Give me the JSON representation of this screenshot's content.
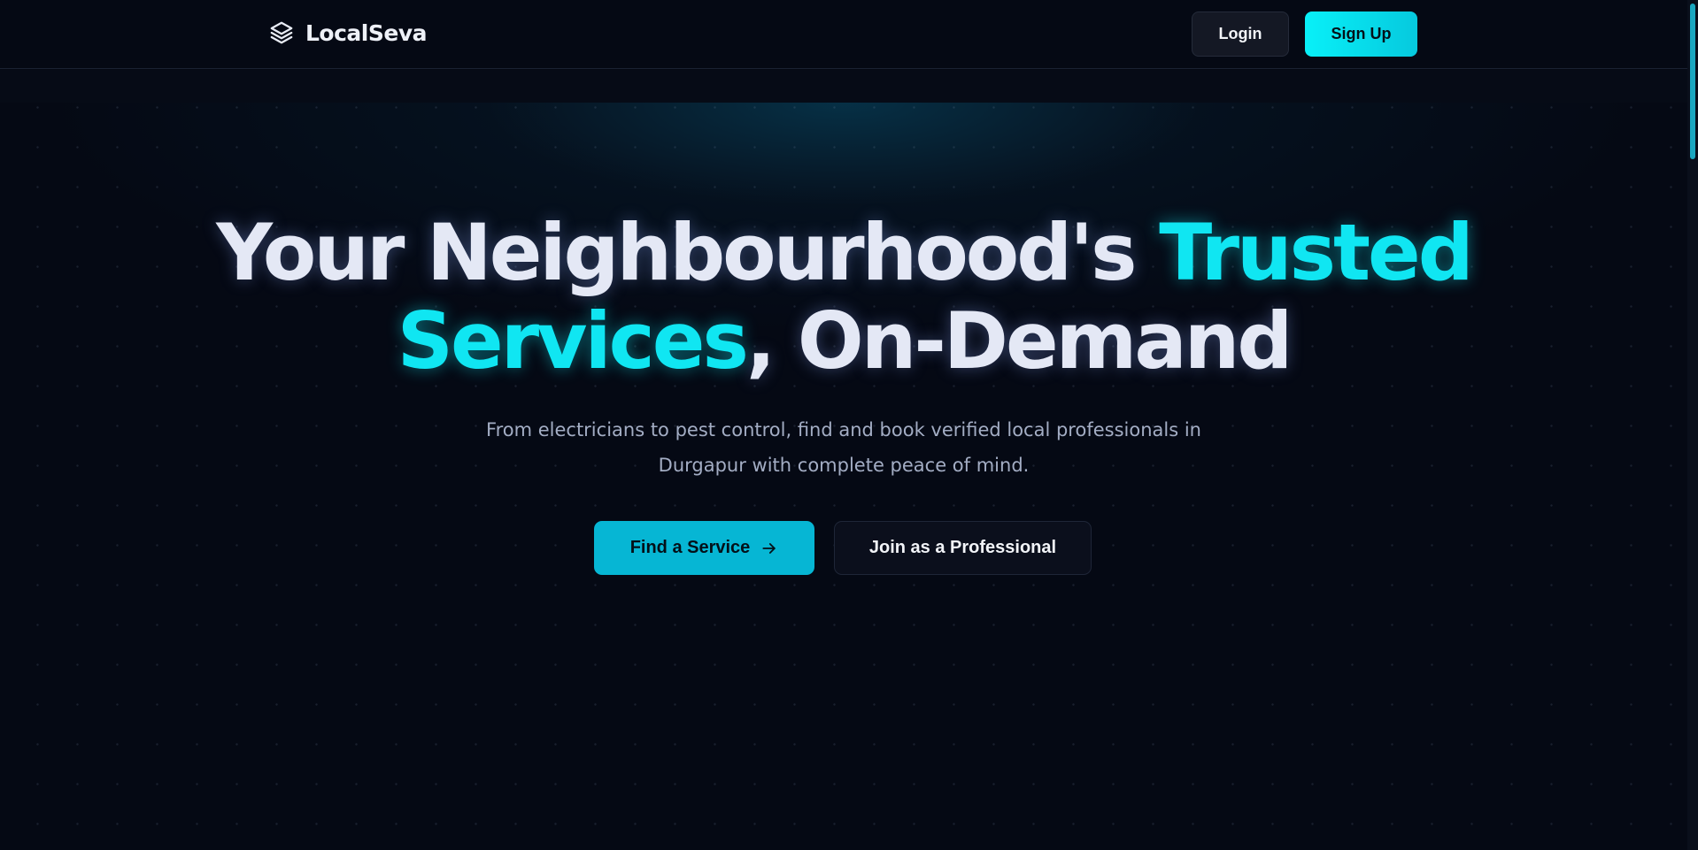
{
  "header": {
    "brand_name": "LocalSeva",
    "brand_icon": "layers-icon",
    "login_label": "Login",
    "signup_label": "Sign Up"
  },
  "hero": {
    "headline_part1": "Your Neighbourhood's ",
    "headline_highlight1": "Trusted",
    "headline_highlight2": "Services",
    "headline_part2": ", On-Demand",
    "subtext": "From electricians to pest control, find and book verified local professionals in Durgapur with complete peace of mind.",
    "find_service_label": "Find a Service",
    "find_service_icon": "arrow-right-icon",
    "join_label": "Join as a Professional"
  },
  "colors": {
    "background": "#050914",
    "accent": "#10e6f2",
    "accent_button": "#06b6d4",
    "text_primary": "#e4e8f5",
    "text_muted": "#a3adc4"
  }
}
